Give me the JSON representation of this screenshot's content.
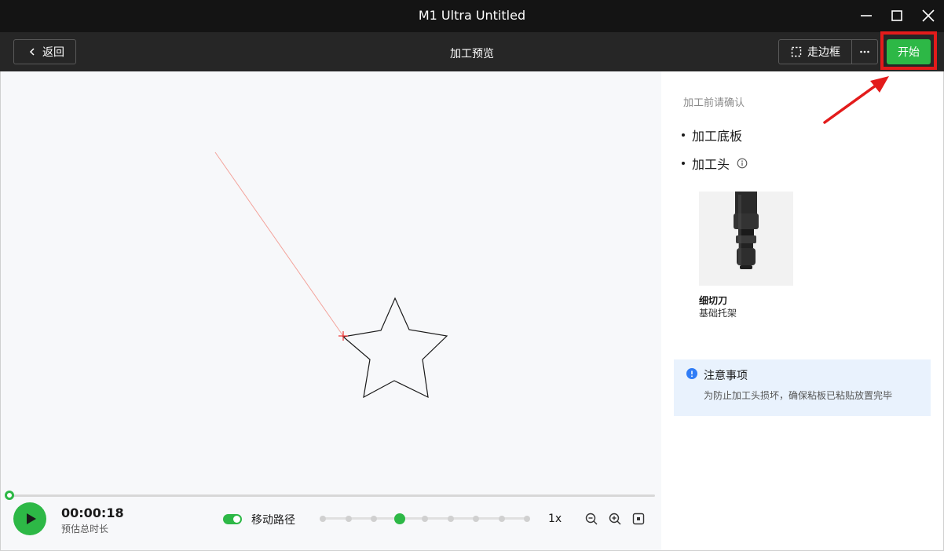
{
  "window": {
    "title": "M1 Ultra Untitled"
  },
  "toolbar": {
    "back_label": "返回",
    "page_title": "加工预览",
    "frame_label": "走边框",
    "start_label": "开始"
  },
  "playback": {
    "time": "00:00:18",
    "time_label": "预估总时长",
    "path_toggle_label": "移动路径",
    "path_toggle_on": true,
    "speed": "1x",
    "speed_steps": 9,
    "speed_active_index": 3,
    "progress": 0
  },
  "panel": {
    "confirm_title": "加工前请确认",
    "items": [
      {
        "label": "加工底板"
      },
      {
        "label": "加工头"
      }
    ],
    "tool": {
      "name": "细切刀",
      "holder": "基础托架"
    },
    "notice": {
      "title": "注意事项",
      "text": "为防止加工头损坏，确保粘板已粘贴放置完毕"
    }
  },
  "colors": {
    "accent": "#2db846",
    "highlight": "#e31b1b",
    "titlebar": "#141414",
    "toolbar": "#262626",
    "notice_bg": "#e9f2fd"
  },
  "icons": {
    "back": "chevron-left-icon",
    "frame": "dashed-frame-icon",
    "more": "more-dots-icon",
    "minimize": "minimize-icon",
    "maximize": "maximize-icon",
    "close": "close-icon",
    "play": "play-icon",
    "zoom_out": "zoom-out-icon",
    "zoom_in": "zoom-in-icon",
    "fit": "fit-view-icon",
    "info": "info-icon",
    "notice": "notice-info-icon"
  }
}
